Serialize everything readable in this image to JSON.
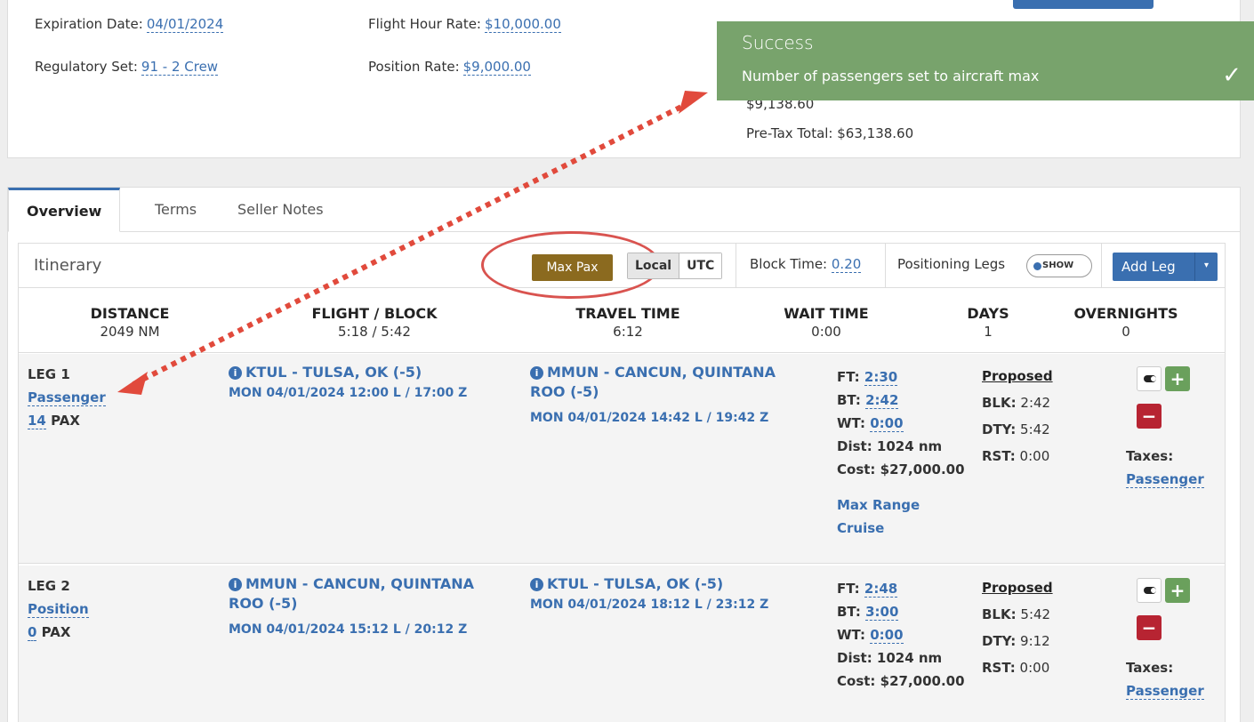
{
  "details": {
    "expiration_label": "Expiration Date:",
    "expiration_value": "04/01/2024",
    "regset_label": "Regulatory Set:",
    "regset_value": "91 - 2 Crew",
    "flight_rate_label": "Flight Hour Rate:",
    "flight_rate_value": "$10,000.00",
    "position_rate_label": "Position Rate:",
    "position_rate_value": "$9,000.00",
    "partial_value": "$9,138.60",
    "pretax": "Pre-Tax Total: $63,138.60"
  },
  "toast": {
    "title": "Success",
    "message": "Number of passengers set to aircraft max",
    "check": "✓",
    "color": "#78a36c"
  },
  "tabs": [
    "Overview",
    "Terms",
    "Seller Notes"
  ],
  "itinerary": {
    "title": "Itinerary",
    "max_pax": "Max Pax",
    "tz_local": "Local",
    "tz_utc": "UTC",
    "block_time_label": "Block Time:",
    "block_time_value": "0.20",
    "positioning_legs": "Positioning Legs",
    "positioning_toggle": "SHOW",
    "add_leg": "Add Leg",
    "add_leg_caret": "▾"
  },
  "summary": [
    {
      "label": "DISTANCE",
      "value": "2049 NM"
    },
    {
      "label": "FLIGHT / BLOCK",
      "value": "5:18 / 5:42"
    },
    {
      "label": "TRAVEL TIME",
      "value": "6:12"
    },
    {
      "label": "WAIT TIME",
      "value": "0:00"
    },
    {
      "label": "DAYS",
      "value": "1"
    },
    {
      "label": "OVERNIGHTS",
      "value": "0"
    }
  ],
  "legs": [
    {
      "name": "LEG 1",
      "type": "Passenger",
      "pax_count": "14",
      "pax_label": "PAX",
      "from_line1": "KTUL - TULSA, OK (-5)",
      "from_line2": "",
      "from_time": "MON 04/01/2024 12:00 L / 17:00 Z",
      "to_line1": "MMUN - CANCUN, QUINTANA",
      "to_line2": "ROO (-5)",
      "to_time": "MON 04/01/2024 14:42 L / 19:42 Z",
      "ft": "2:30",
      "bt": "2:42",
      "wt": "0:00",
      "dist": "Dist: 1024 nm",
      "cost": "Cost: $27,000.00",
      "range1": "Max Range",
      "range2": "Cruise",
      "proposed": "Proposed",
      "blk": "2:42",
      "dty": "5:42",
      "rst": "0:00",
      "taxes_label": "Taxes:",
      "taxes_value": "Passenger"
    },
    {
      "name": "LEG 2",
      "type": "Position",
      "pax_count": "0",
      "pax_label": "PAX",
      "from_line1": "MMUN - CANCUN, QUINTANA",
      "from_line2": "ROO (-5)",
      "from_time": "MON 04/01/2024 15:12 L / 20:12 Z",
      "to_line1": "KTUL - TULSA, OK (-5)",
      "to_line2": "",
      "to_time": "MON 04/01/2024 18:12 L / 23:12 Z",
      "ft": "2:48",
      "bt": "3:00",
      "wt": "0:00",
      "dist": "Dist: 1024 nm",
      "cost": "Cost: $27,000.00",
      "proposed": "Proposed",
      "blk": "5:42",
      "dty": "9:12",
      "rst": "0:00",
      "taxes_label": "Taxes:",
      "taxes_value": "Passenger"
    }
  ],
  "labels": {
    "ft": "FT:",
    "bt": "BT:",
    "wt": "WT:",
    "blk": "BLK:",
    "dty": "DTY:",
    "rst": "RST:",
    "plus": "+",
    "minus": "−",
    "info": "i"
  }
}
